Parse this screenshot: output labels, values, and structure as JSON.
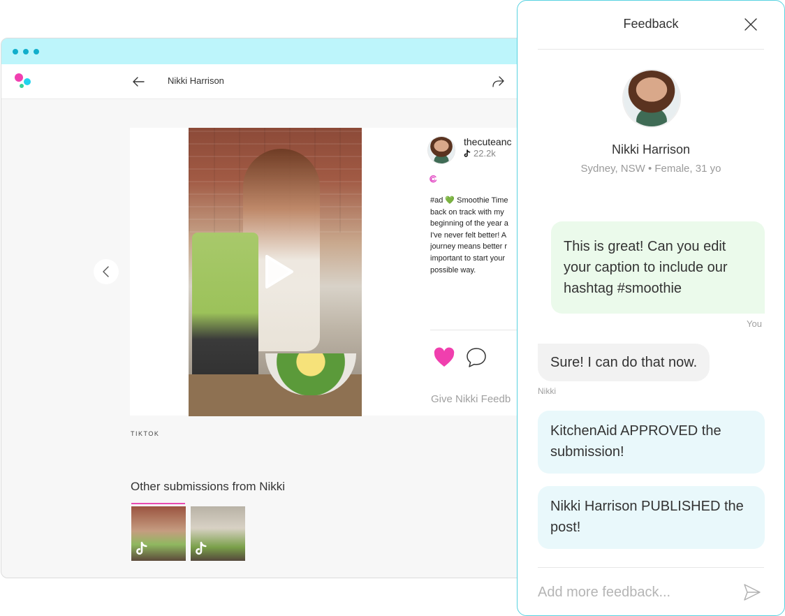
{
  "browser": {
    "header": {
      "title": "Nikki Harrison"
    },
    "post": {
      "handle": "thecuteanc",
      "followers": "22.2k",
      "caption": "#ad 💚 Smoothie Time\nback on track with my\nbeginning of the year a\nI've never felt better! A\njourney means better r\nimportant to start your\npossible way.",
      "give_feedback": "Give Nikki Feedb"
    },
    "platform": "TIKTOK",
    "other_submissions_title": "Other submissions from Nikki"
  },
  "panel": {
    "title": "Feedback",
    "profile": {
      "name": "Nikki Harrison",
      "meta": "Sydney, NSW • Female, 31 yo"
    },
    "messages": {
      "you": {
        "text": "This is great! Can you edit your caption to include our hashtag #smoothie",
        "author": "You"
      },
      "nikki": {
        "text": "Sure! I can do that now.",
        "author": "Nikki"
      },
      "status1": {
        "text": "KitchenAid APPROVED the submission!"
      },
      "status2": {
        "text": "Nikki Harrison PUBLISHED the post!"
      }
    },
    "input": {
      "placeholder": "Add more feedback..."
    }
  },
  "colors": {
    "titlebar": "#bdf5fb",
    "panel_border": "#57d2e0",
    "heart": "#f03fae",
    "you_bubble": "#ebfaeb",
    "status_bubble": "#e9f8fb"
  },
  "icons": [
    "back-arrow-icon",
    "share-icon",
    "play-icon",
    "tiktok-icon",
    "swirl-icon",
    "heart-icon",
    "comment-icon",
    "chevron-left-icon",
    "close-icon",
    "send-icon"
  ]
}
